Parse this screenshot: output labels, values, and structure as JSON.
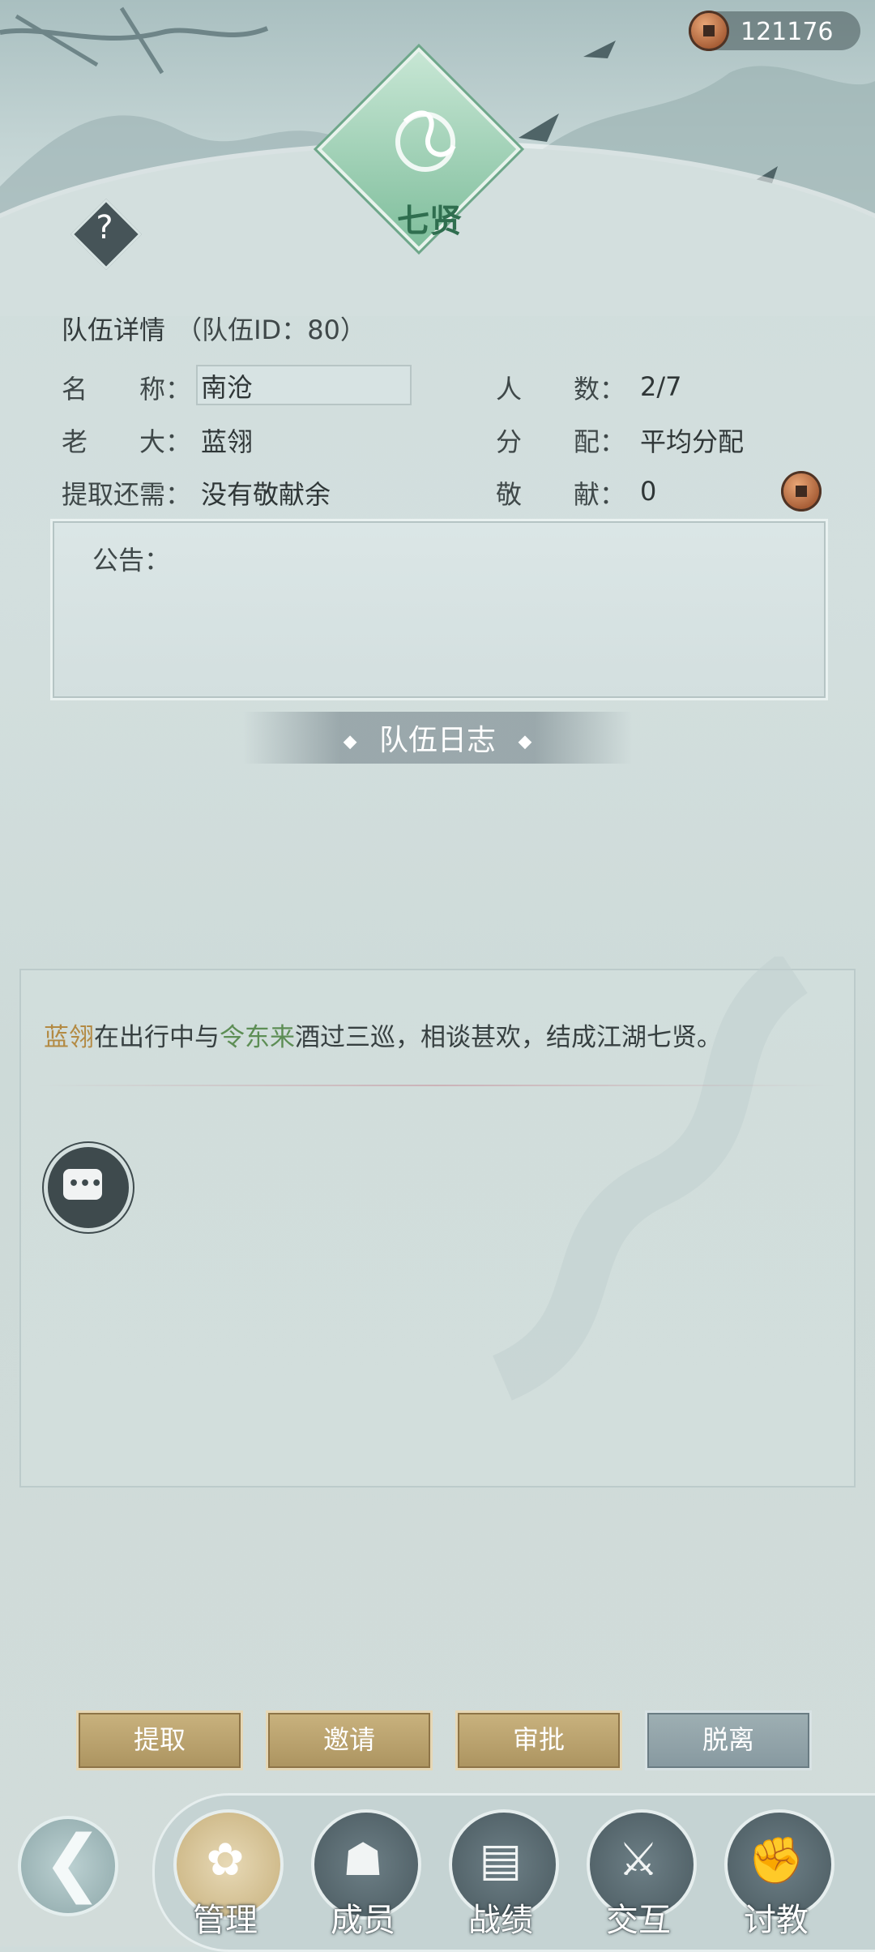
{
  "currency": {
    "icon": "copper-coin-icon",
    "amount": "121176"
  },
  "emblem": {
    "name": "七贤",
    "icon": "team-emblem-icon"
  },
  "help": {
    "label": "?"
  },
  "details": {
    "title": "队伍详情",
    "team_id": "（队伍ID：80）",
    "name_label": "名　　称：",
    "name_value": "南沧",
    "leader_label": "老　　大：",
    "leader_value": "蓝翎",
    "withdraw_label": "提取还需：",
    "withdraw_value": "没有敬献余",
    "members_label": "人　　数：",
    "members_value": "2/7",
    "distribution_label": "分　　配：",
    "distribution_value": "平均分配",
    "contribution_label": "敬　　献：",
    "contribution_value": "0"
  },
  "notice": {
    "label": "公告："
  },
  "log": {
    "title": "队伍日志",
    "entry": {
      "actor": "蓝翎",
      "part1": "在出行中与",
      "partner": "令东来",
      "part2": "酒过三巡，相谈甚欢，结成江湖七贤。"
    },
    "chat_icon": "chat-bubble-icon"
  },
  "actions": {
    "withdraw": "提取",
    "invite": "邀请",
    "approve": "审批",
    "leave": "脱离"
  },
  "nav": {
    "back_icon": "back-arrow-icon",
    "items": [
      {
        "label": "管理",
        "icon": "manage-icon",
        "active": true
      },
      {
        "label": "成员",
        "icon": "members-icon",
        "active": false
      },
      {
        "label": "战绩",
        "icon": "record-icon",
        "active": false
      },
      {
        "label": "交互",
        "icon": "interact-icon",
        "active": false
      },
      {
        "label": "讨教",
        "icon": "challenge-icon",
        "active": false
      }
    ]
  }
}
